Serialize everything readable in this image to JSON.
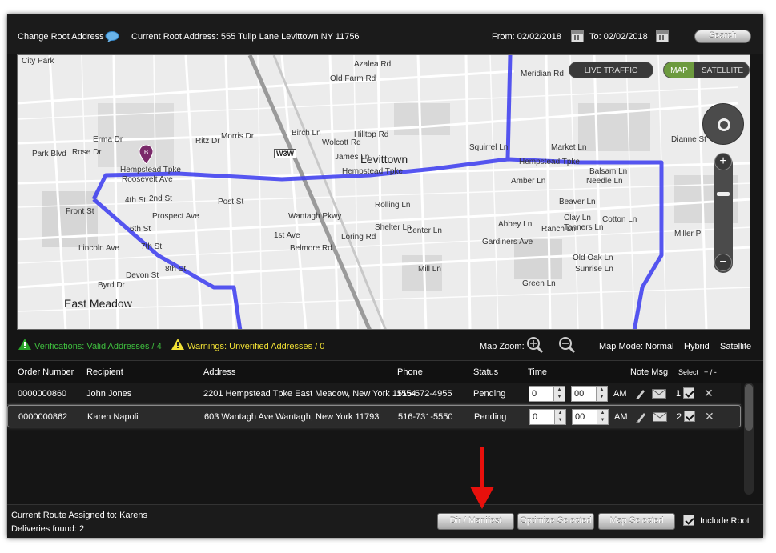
{
  "topbar": {
    "change_root_label": "Change Root Address",
    "current_root_label": "Current Root Address: 555 Tulip Lane Levittown NY 11756",
    "from_label": "From: 02/02/2018",
    "to_label": "To: 02/02/2018",
    "search_label": "Search"
  },
  "map": {
    "live_traffic_label": "LIVE TRAFFIC",
    "map_label": "MAP",
    "satellite_label": "SATELLITE",
    "pin_label": "B",
    "labels": {
      "levittown": "Levittown",
      "east_meadow": "East Meadow",
      "hempstead_tpke_1": "Hempstead Tpke",
      "hempstead_tpke_2": "Hempstead Tpke",
      "hempstead_tpke_3": "Hempstead Tpke",
      "old_farm": "Old Farm Rd",
      "meridian": "Meridian Rd",
      "azalea": "Azalea Rd",
      "birch": "Birch Ln",
      "squirrel": "Squirrel Ln",
      "market": "Market Ln",
      "balsam": "Balsam Ln",
      "needle": "Needle Ln",
      "amber": "Amber Ln",
      "beaver": "Beaver Ln",
      "clay": "Clay Ln",
      "tanners": "Tanners Ln",
      "old_oak": "Old Oak Ln",
      "sunrise": "Sunrise Ln",
      "green": "Green Ln",
      "rolling": "Rolling Ln",
      "shelter": "Shelter Ln",
      "first_ave": "1st Ave",
      "belmore": "Belmore Rd",
      "wantagh": "Wantagh Pkwy",
      "loring": "Loring Rd",
      "w3w": "W3W",
      "roosevelt": "Roosevelt Ave",
      "prospect": "Prospect Ave",
      "front": "Front St",
      "lincoln": "Lincoln Ave",
      "byrd": "Byrd Dr",
      "devon": "Devon St",
      "eighth": "8th St",
      "seventh": "7th St",
      "sixth": "6th St",
      "second": "2nd St",
      "fourth": "4th St",
      "post": "Post St",
      "dianne": "Dianne St",
      "miller": "Miller Pl",
      "gardiners": "Gardiners Ave",
      "abbey": "Abbey Ln",
      "center": "Center Ln",
      "mill": "Mill Ln",
      "ranch": "Ranch Ln",
      "cotton": "Cotton Ln",
      "hilltop": "Hilltop Rd",
      "wolcott": "Wolcott Rd",
      "james": "James Ln",
      "erma": "Erma Dr",
      "park": "Park Blvd",
      "rose": "Rose Dr",
      "ritz": "Ritz Dr",
      "morris": "Morris Dr",
      "city_park": "City Park"
    }
  },
  "status": {
    "verifications": "Verifications: Valid Addresses / 4",
    "warnings": "Warnings: Unverified Addresses / 0",
    "map_zoom_label": "Map Zoom:",
    "map_mode_label": "Map Mode:",
    "mode_normal": "Normal",
    "mode_hybrid": "Hybrid",
    "mode_satellite": "Satellite",
    "verify_color": "#3fbf3f",
    "warn_color": "#f2e135"
  },
  "table": {
    "headers": {
      "order_number": "Order Number",
      "recipient": "Recipient",
      "address": "Address",
      "phone": "Phone",
      "status": "Status",
      "time": "Time",
      "note_msg": "Note Msg",
      "select": "Select",
      "plus_minus": "+ / -"
    },
    "rows": [
      {
        "order_number": "0000000860",
        "recipient": "John Jones",
        "address": "2201 Hempstead Tpke East Meadow, New York 11554",
        "phone": "516-572-4955",
        "status": "Pending",
        "hour": "0",
        "minute": "00",
        "ampm": "AM",
        "index": "1"
      },
      {
        "order_number": "0000000862",
        "recipient": "Karen Napoli",
        "address": "603 Wantagh Ave Wantagh, New York 11793",
        "phone": "516-731-5550",
        "status": "Pending",
        "hour": "0",
        "minute": "00",
        "ampm": "AM",
        "index": "2"
      }
    ]
  },
  "footer": {
    "assigned": "Current Route Assigned to: Karens",
    "deliveries": "Deliveries found: 2",
    "dir_manifest_label": "Dir / Manifest",
    "optimize_label": "Optimize Selected",
    "map_selected_label": "Map Selected",
    "include_root_label": "Include Root"
  },
  "colors": {
    "route": "#3a3af0",
    "accent_green": "#6c9a3e",
    "arrow_red": "#e8100c"
  }
}
